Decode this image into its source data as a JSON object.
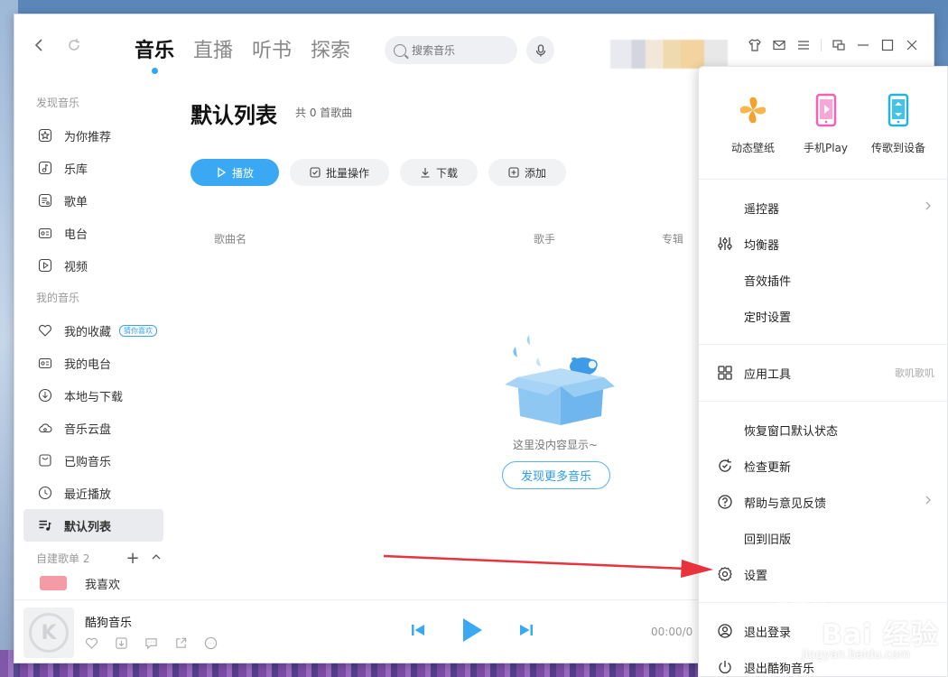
{
  "nav": {
    "back_icon": "chevron-left-icon",
    "refresh_icon": "refresh-icon"
  },
  "main_tabs": [
    {
      "label": "音乐",
      "active": true
    },
    {
      "label": "直播",
      "active": false
    },
    {
      "label": "听书",
      "active": false
    },
    {
      "label": "探索",
      "active": false
    }
  ],
  "search": {
    "placeholder": "搜索音乐"
  },
  "sidebar": {
    "group_discover": "发现音乐",
    "discover_items": [
      {
        "label": "为你推荐",
        "icon": "star-icon"
      },
      {
        "label": "乐库",
        "icon": "music-library-icon"
      },
      {
        "label": "歌单",
        "icon": "playlist-icon"
      },
      {
        "label": "电台",
        "icon": "radio-icon"
      },
      {
        "label": "视频",
        "icon": "video-icon"
      }
    ],
    "group_mine": "我的音乐",
    "mine_items": [
      {
        "label": "我的收藏",
        "icon": "heart-icon",
        "badge": "猜你喜欢"
      },
      {
        "label": "我的电台",
        "icon": "radio-icon"
      },
      {
        "label": "本地与下载",
        "icon": "download-icon"
      },
      {
        "label": "音乐云盘",
        "icon": "cloud-icon"
      },
      {
        "label": "已购音乐",
        "icon": "purchased-icon"
      },
      {
        "label": "最近播放",
        "icon": "clock-icon"
      },
      {
        "label": "默认列表",
        "icon": "list-icon",
        "active": true
      }
    ],
    "custom_group": "自建歌单 2",
    "custom_first": "我喜欢"
  },
  "content": {
    "title": "默认列表",
    "count": "共 0 首歌曲",
    "actions": [
      {
        "label": "播放",
        "primary": true
      },
      {
        "label": "批量操作"
      },
      {
        "label": "下载"
      },
      {
        "label": "添加"
      }
    ],
    "columns": [
      "歌曲名",
      "歌手",
      "专辑"
    ],
    "empty_text": "这里没内容显示~",
    "discover_button": "发现更多音乐"
  },
  "player": {
    "song_title": "酷狗音乐",
    "time": "00:00/0"
  },
  "menu": {
    "features": [
      {
        "label": "动态壁纸",
        "icon": "pinwheel-icon",
        "color": "#f6a12b"
      },
      {
        "label": "手机Play",
        "icon": "phone-play-icon",
        "color": "#ee63b7"
      },
      {
        "label": "传歌到设备",
        "icon": "transfer-device-icon",
        "color": "#23b3dc"
      }
    ],
    "sections": [
      [
        {
          "label": "遥控器",
          "icon": "",
          "chevron": true
        },
        {
          "label": "均衡器",
          "icon": "equalizer-icon"
        },
        {
          "label": "音效插件",
          "icon": ""
        },
        {
          "label": "定时设置",
          "icon": ""
        }
      ],
      [
        {
          "label": "应用工具",
          "icon": "apps-grid-icon",
          "extra": "歌叽歌叽"
        }
      ],
      [
        {
          "label": "恢复窗口默认状态",
          "icon": ""
        },
        {
          "label": "检查更新",
          "icon": "update-icon"
        },
        {
          "label": "帮助与意见反馈",
          "icon": "help-icon",
          "chevron": true
        },
        {
          "label": "回到旧版",
          "icon": ""
        },
        {
          "label": "设置",
          "icon": "gear-icon"
        }
      ],
      [
        {
          "label": "退出登录",
          "icon": "logout-user-icon"
        },
        {
          "label": "退出酷狗音乐",
          "icon": "power-icon"
        }
      ]
    ]
  },
  "watermark": {
    "text": "Bai 经验",
    "sub": "jingyan.baidu.com"
  },
  "colors": {
    "accent": "#3aa8f3",
    "annotation": "#e8323c"
  }
}
